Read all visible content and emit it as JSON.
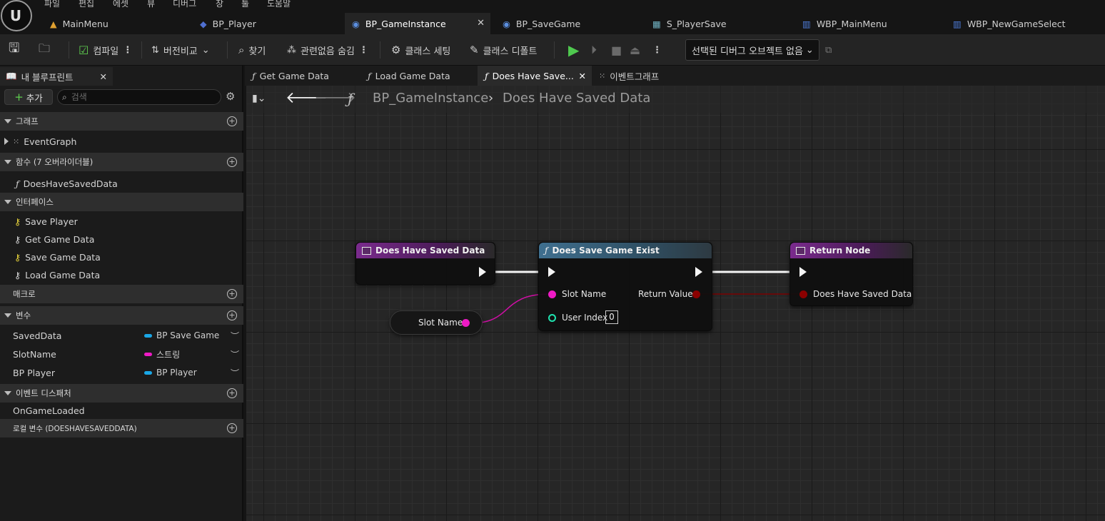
{
  "menu": [
    "파일",
    "편집",
    "에셋",
    "뷰",
    "디버그",
    "창",
    "툴",
    "도움말"
  ],
  "asset_tabs": [
    {
      "label": "MainMenu",
      "icon": "level-icon"
    },
    {
      "label": "BP_Player",
      "icon": "blueprint-icon"
    },
    {
      "label": "BP_GameInstance",
      "icon": "blueprint-class-icon",
      "active": true
    },
    {
      "label": "BP_SaveGame",
      "icon": "blueprint-class-icon"
    },
    {
      "label": "S_PlayerSave",
      "icon": "struct-icon"
    },
    {
      "label": "WBP_MainMenu",
      "icon": "widget-icon"
    },
    {
      "label": "WBP_NewGameSelect",
      "icon": "widget-icon"
    }
  ],
  "toolbar": {
    "compile": "컴파일",
    "diff": "버전비교",
    "find": "찾기",
    "hide_unrelated": "관련없음 숨김",
    "class_settings": "클래스 세팅",
    "class_defaults": "클래스 디폴트",
    "debug_object": "선택된 디버그 오브젝트 없음"
  },
  "left_panel": {
    "tab_title": "내 블루프린트",
    "add_label": "추가",
    "search_placeholder": "검색",
    "sections": {
      "graphs": {
        "title": "그래프",
        "items": [
          "EventGraph"
        ]
      },
      "functions": {
        "title": "함수 (7 오버라이더블)",
        "items": [
          "DoesHaveSavedData"
        ]
      },
      "interfaces": {
        "title": "인터페이스",
        "items": [
          "Save Player",
          "Get Game Data",
          "Save Game Data",
          "Load Game Data"
        ]
      },
      "macros": {
        "title": "매크로"
      },
      "variables": {
        "title": "변수",
        "items": [
          {
            "name": "SavedData",
            "type": "BP Save Game",
            "color": "#1aa7e6"
          },
          {
            "name": "SlotName",
            "type": "스트링",
            "color": "#ee1ac5"
          },
          {
            "name": "BP Player",
            "type": "BP Player",
            "color": "#1aa7e6"
          }
        ]
      },
      "dispatchers": {
        "title": "이벤트 디스패처",
        "items": [
          "OnGameLoaded"
        ]
      },
      "locals": {
        "title": "로컬 변수 (DOESHAVESAVEDDATA)"
      }
    }
  },
  "graph_tabs": [
    "Get Game Data",
    "Load Game Data",
    "Does Have Save...",
    "이벤트그래프"
  ],
  "breadcrumb": {
    "root": "BP_GameInstance",
    "current": "Does Have Saved Data"
  },
  "nodes": {
    "entry": {
      "title": "Does Have Saved Data"
    },
    "var": {
      "label": "Slot Name"
    },
    "call": {
      "title": "Does Save Game Exist",
      "pin_slot": "Slot Name",
      "pin_user": "User Index",
      "user_index": "0",
      "pin_return": "Return Value"
    },
    "return": {
      "title": "Return Node",
      "pin": "Does Have Saved Data"
    }
  },
  "colors": {
    "string_pin": "#ee1ac5",
    "bool_pin": "#8b0000",
    "int_pin": "#1fe3af",
    "object_pin": "#1aa7e6"
  }
}
